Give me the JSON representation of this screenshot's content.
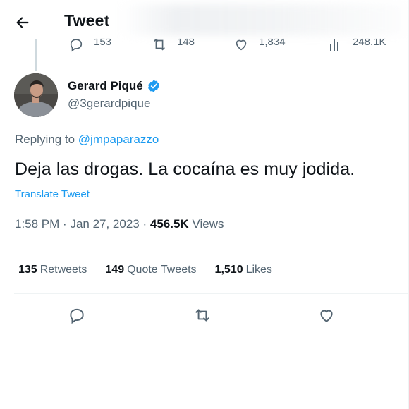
{
  "header": {
    "title": "Tweet",
    "back_icon": "arrow-left-icon"
  },
  "previous_tweet": {
    "replies": "153",
    "retweets": "148",
    "likes": "1,834",
    "views": "248.1K"
  },
  "tweet": {
    "author": {
      "name": "Gerard Piqué",
      "handle": "@3gerardpique",
      "verified": true
    },
    "replying_prefix": "Replying to",
    "replying_to": "@jmpaparazzo",
    "text": "Deja las drogas. La cocaína es muy jodida.",
    "translate_label": "Translate Tweet",
    "time": "1:58 PM",
    "date": "Jan 27, 2023",
    "views_count": "456.5K",
    "views_label": "Views"
  },
  "stats": {
    "retweets_count": "135",
    "retweets_label": "Retweets",
    "quotes_count": "149",
    "quotes_label": "Quote Tweets",
    "likes_count": "1,510",
    "likes_label": "Likes"
  },
  "colors": {
    "accent": "#1d9bf0",
    "text_primary": "#0f1419",
    "text_secondary": "#536471",
    "divider": "#eff3f4"
  },
  "icons": [
    "arrow-left-icon",
    "verified-badge-icon",
    "reply-icon",
    "retweet-icon",
    "like-icon",
    "views-icon"
  ]
}
